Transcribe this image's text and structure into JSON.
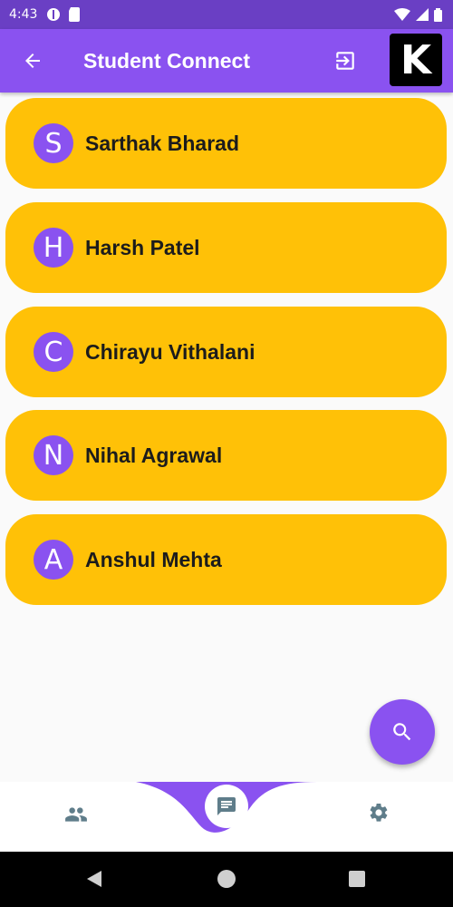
{
  "status_bar": {
    "time": "4:43"
  },
  "app_bar": {
    "title": "Student Connect",
    "badge_letter": "K"
  },
  "students": [
    {
      "initial": "S",
      "name": "Sarthak Bharad"
    },
    {
      "initial": "H",
      "name": "Harsh Patel"
    },
    {
      "initial": "C",
      "name": "Chirayu Vithalani"
    },
    {
      "initial": "N",
      "name": "Nihal Agrawal"
    },
    {
      "initial": "A",
      "name": "Anshul Mehta"
    }
  ],
  "icons": {
    "back": "arrow-left-icon",
    "logout": "logout-icon",
    "search": "search-icon",
    "people": "people-icon",
    "chat": "chat-icon",
    "settings": "gear-icon"
  },
  "colors": {
    "primary": "#8a52f0",
    "status_bar": "#6a3fc4",
    "card": "#ffc107",
    "nav_icon": "#5f7d8a"
  }
}
